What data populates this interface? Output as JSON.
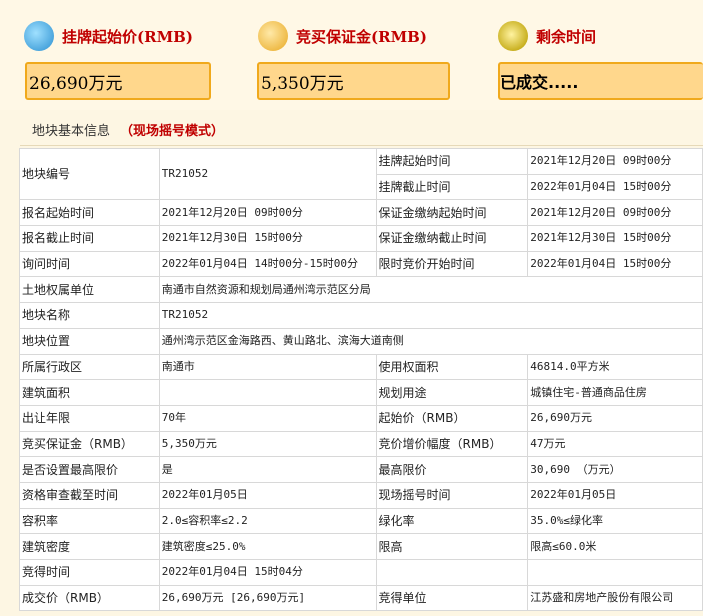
{
  "header": {
    "start_price": {
      "label": "挂牌起始价(RMB)",
      "value": "26,690万元",
      "icon": "coin-calculator-icon"
    },
    "deposit": {
      "label": "竞买保证金(RMB)",
      "value": "5,350万元",
      "icon": "money-bag-icon"
    },
    "remaining": {
      "label": "剩余时间",
      "value": "已成交.....",
      "icon": "alarm-clock-icon"
    }
  },
  "section": {
    "title": "地块基本信息",
    "mode": "（现场摇号模式）"
  },
  "table": {
    "parcel_no": {
      "label": "地块编号",
      "value": "TR21052"
    },
    "listing_start": {
      "label": "挂牌起始时间",
      "value": "2021年12月20日 09时00分"
    },
    "listing_end": {
      "label": "挂牌截止时间",
      "value": "2022年01月04日 15时00分"
    },
    "rows": [
      {
        "l1": "报名起始时间",
        "v1": "2021年12月20日 09时00分",
        "l2": "保证金缴纳起始时间",
        "v2": "2021年12月20日 09时00分"
      },
      {
        "l1": "报名截止时间",
        "v1": "2021年12月30日 15时00分",
        "l2": "保证金缴纳截止时间",
        "v2": "2021年12月30日 15时00分"
      },
      {
        "l1": "询问时间",
        "v1": "2022年01月04日 14时00分-15时00分",
        "l2": "限时竞价开始时间",
        "v2": "2022年01月04日 15时00分"
      }
    ],
    "wide_rows": [
      {
        "label": "土地权属单位",
        "value": "南通市自然资源和规划局通州湾示范区分局"
      },
      {
        "label": "地块名称",
        "value": "TR21052"
      },
      {
        "label": "地块位置",
        "value": "通州湾示范区金海路西、黄山路北、滨海大道南侧"
      }
    ],
    "rows2": [
      {
        "l1": "所属行政区",
        "v1": "南通市",
        "l2": "使用权面积",
        "v2": "46814.0平方米"
      },
      {
        "l1": "建筑面积",
        "v1": "",
        "l2": "规划用途",
        "v2": "城镇住宅-普通商品住房"
      },
      {
        "l1": "出让年限",
        "v1": "70年",
        "l2": "起始价（RMB）",
        "v2": "26,690万元"
      },
      {
        "l1": "竞买保证金（RMB）",
        "v1": "5,350万元",
        "l2": "竞价增价幅度（RMB）",
        "v2": "47万元"
      },
      {
        "l1": "是否设置最高限价",
        "v1": "是",
        "l2": "最高限价",
        "v2": "30,690 （万元）"
      },
      {
        "l1": "资格审查截至时间",
        "v1": "2022年01月05日",
        "l2": "现场摇号时间",
        "v2": "2022年01月05日"
      },
      {
        "l1": "容积率",
        "v1": "2.0≤容积率≤2.2",
        "l2": "绿化率",
        "v2": "35.0%≤绿化率"
      },
      {
        "l1": "建筑密度",
        "v1": "建筑密度≤25.0%",
        "l2": "限高",
        "v2": "限高≤60.0米"
      },
      {
        "l1": "竞得时间",
        "v1": "2022年01月04日 15时04分",
        "l2": "",
        "v2": ""
      },
      {
        "l1": "成交价（RMB）",
        "v1": "26,690万元 [26,690万元]",
        "l2": "竞得单位",
        "v2": "江苏盛和房地产股份有限公司"
      }
    ]
  }
}
